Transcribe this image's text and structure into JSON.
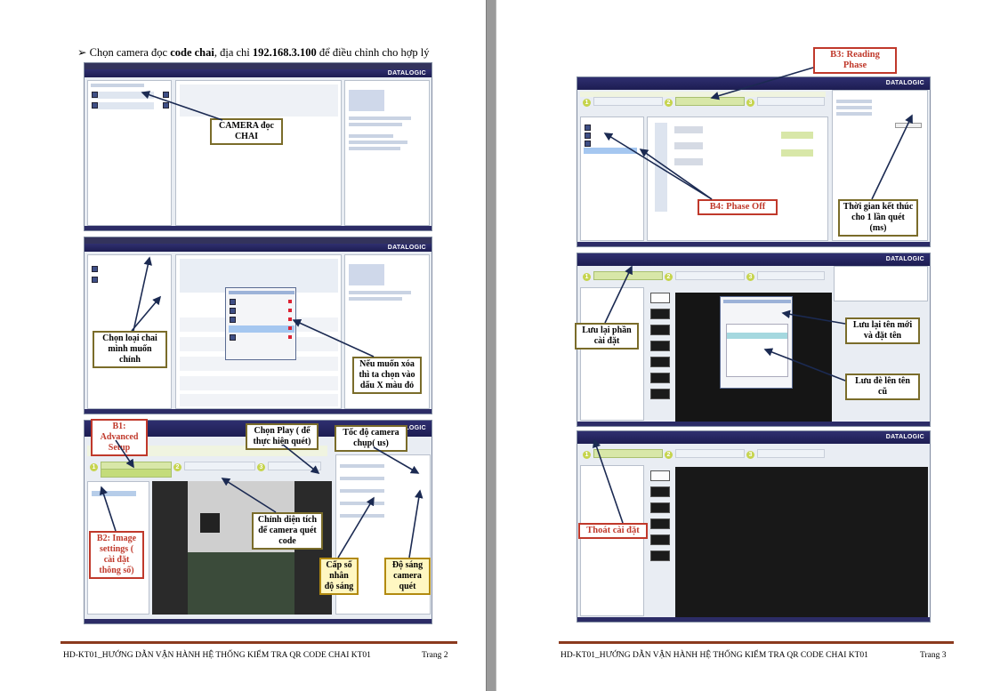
{
  "page_left": {
    "heading": {
      "bullet": "➢",
      "pre": "Chọn camera đọc ",
      "bold1": "code chai",
      "mid": ", địa chỉ ",
      "bold2": "192.168.3.100",
      "post": " để điều chỉnh cho hợp lý"
    },
    "callouts": {
      "camera": "CAMERA đọc CHAI",
      "select_type": "Chọn loại chai mình muốn chỉnh",
      "delete": "Nếu muốn xóa thì ta chọn vào dấu X màu đỏ",
      "b1": "B1: Advanced Setup",
      "b2": "B2: Image settings ( cài đặt thông số)",
      "play": "Chọn Play ( để thực hiện quét)",
      "speed": "Tốc độ camera chụp( us)",
      "area": "Chỉnh diện tích để camera quét code",
      "gain": "Cấp số nhân độ sáng",
      "bright": "Độ sáng camera quét"
    },
    "footer_title": "HD-KT01_HƯỚNG DẪN VẬN HÀNH HỆ THỐNG KIỂM TRA QR CODE CHAI KT01",
    "footer_page": "Trang 2"
  },
  "page_right": {
    "callouts": {
      "b3": "B3: Reading Phase",
      "b4": "B4: Phase Off",
      "end_time": "Thời gian kết thúc cho 1 lần quét (ms)",
      "save_part": "Lưu lại phần cài đặt",
      "save_new": "Lưu lại tên mới và đặt tên",
      "save_over": "Lưu đè lên tên cũ",
      "exit": "Thoát cài đặt"
    },
    "footer_title": "HD-KT01_HƯỚNG DẪN VẬN HÀNH HỆ THỐNG KIỂM TRA QR CODE CHAI KT01",
    "footer_page": "Trang 3"
  },
  "app": {
    "logo": "DATALOGIC",
    "step_labels": [
      "1",
      "2",
      "3"
    ]
  }
}
